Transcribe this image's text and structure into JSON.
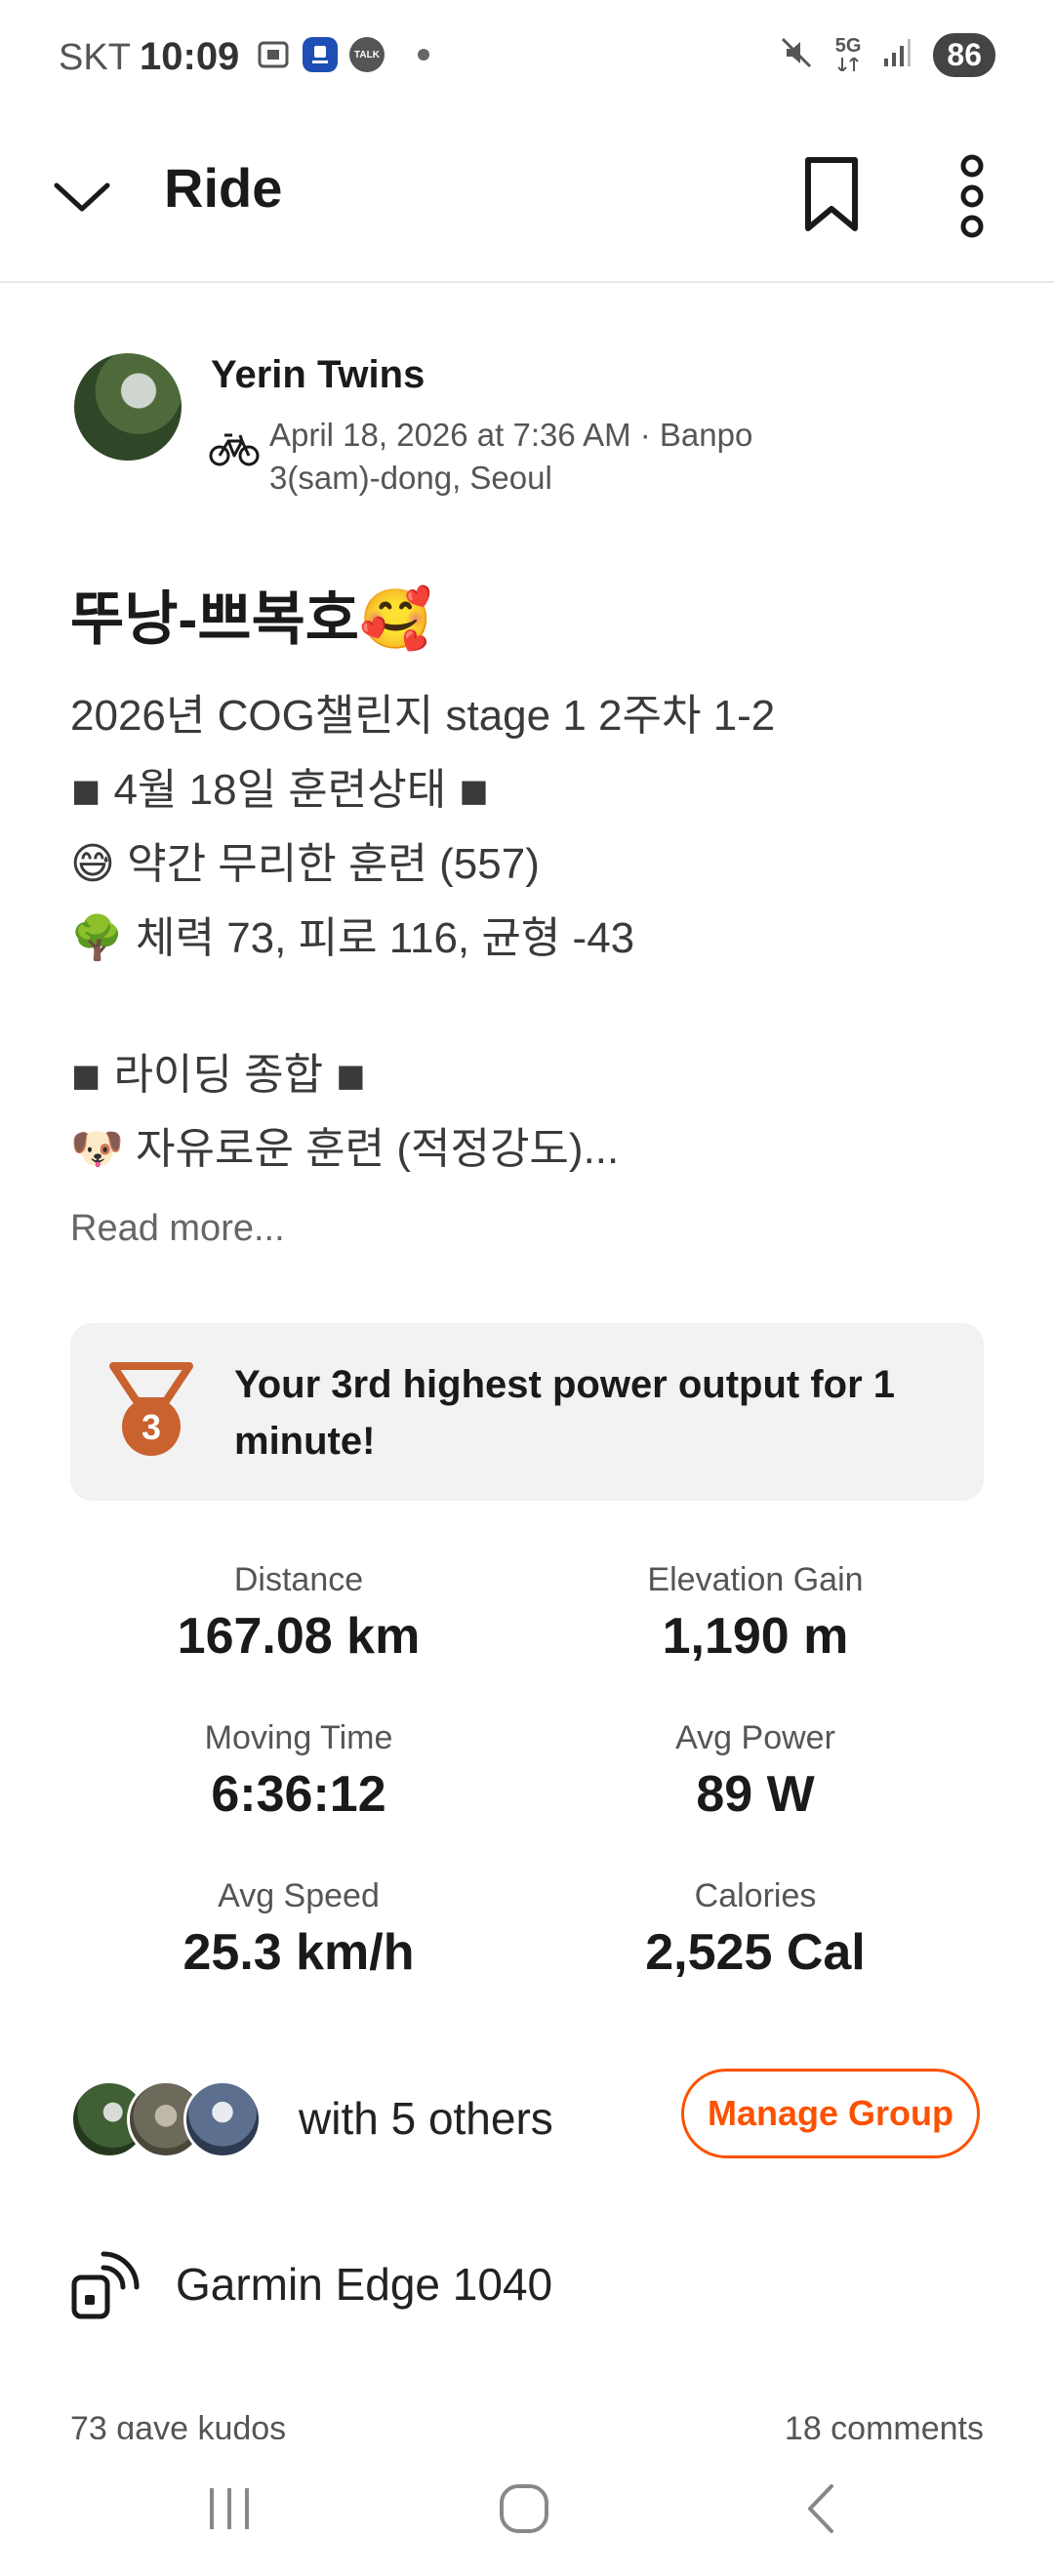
{
  "status_bar": {
    "carrier": "SKT",
    "time": "10:09",
    "icons_left": [
      "screenshot-icon",
      "app-badge-icon",
      "talk-icon"
    ],
    "talk_badge": "TALK",
    "icons_right": [
      "mute-icon",
      "5g-icon",
      "signal-icon"
    ],
    "network": "5G",
    "battery": "86"
  },
  "header": {
    "title": "Ride",
    "back_icon": "chevron-down-icon",
    "bookmark_icon": "bookmark-icon",
    "more_icon": "more-vertical-icon"
  },
  "athlete": {
    "name": "Yerin Twins",
    "activity_type_icon": "bike-icon",
    "datetime_location": "April 18, 2026 at 7:36 AM · Banpo 3(sam)-dong, Seoul"
  },
  "activity": {
    "title": "뚜낭-쁘복호🥰",
    "description_lines": [
      "2026년 COG챌린지 stage 1 2주차 1-2",
      "◾ 4월 18일 훈련상태 ◾",
      "😅 약간 무리한 훈련 (557)",
      "🌳 체력 73, 피로 116, 균형 -43",
      "",
      "◾ 라이딩 종합 ◾",
      "🐶 자유로운 훈련 (적정강도)..."
    ],
    "read_more": "Read more..."
  },
  "achievement": {
    "rank": "3",
    "text": "Your 3rd highest power output for 1 minute!",
    "icon": "medal-icon"
  },
  "stats": [
    {
      "label": "Distance",
      "value": "167.08 km"
    },
    {
      "label": "Elevation Gain",
      "value": "1,190 m"
    },
    {
      "label": "Moving Time",
      "value": "6:36:12"
    },
    {
      "label": "Avg Power",
      "value": "89 W"
    },
    {
      "label": "Avg Speed",
      "value": "25.3 km/h"
    },
    {
      "label": "Calories",
      "value": "2,525 Cal"
    }
  ],
  "group": {
    "with_text": "with 5 others",
    "manage_label": "Manage Group"
  },
  "device": {
    "name": "Garmin Edge 1040",
    "icon": "device-icon"
  },
  "social": {
    "kudos": "73 gave kudos",
    "comments": "18 comments"
  },
  "navbar": {
    "icons": [
      "recents-icon",
      "home-icon",
      "back-icon"
    ]
  },
  "colors": {
    "accent": "#fc5200",
    "medal": "#c9622f"
  }
}
